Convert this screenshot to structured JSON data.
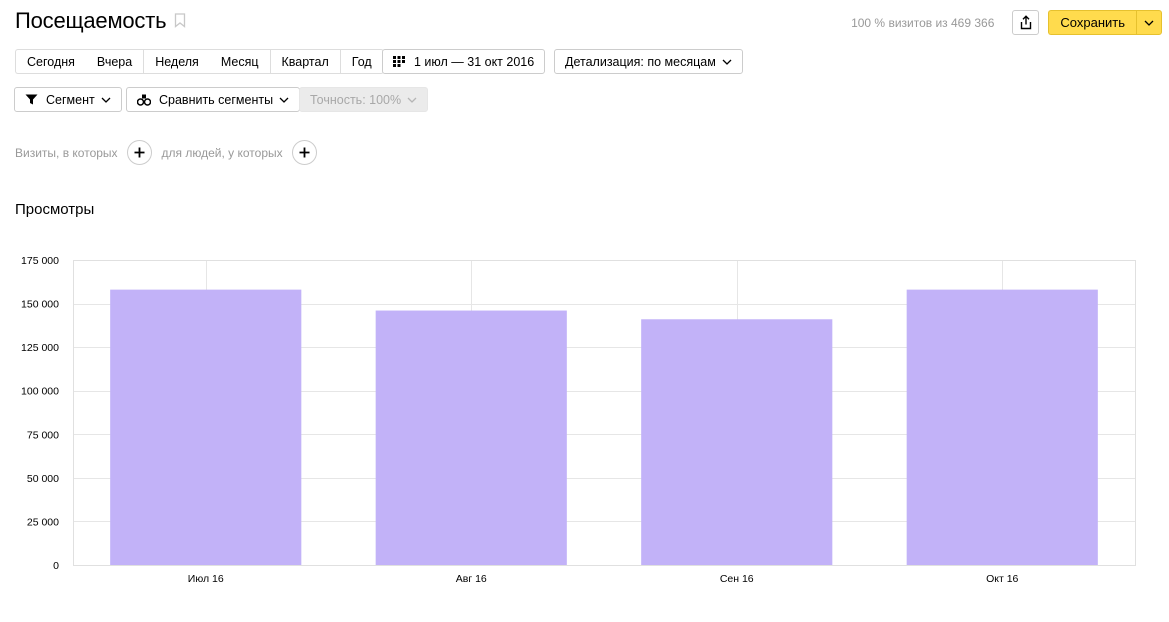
{
  "header": {
    "title": "Посещаемость",
    "visits_info": "100 % визитов из 469 366",
    "save_label": "Сохранить"
  },
  "periods": [
    "Сегодня",
    "Вчера",
    "Неделя",
    "Месяц",
    "Квартал",
    "Год"
  ],
  "date_range": "1 июл — 31 окт 2016",
  "detail_label": "Детализация: по месяцам",
  "segment_label": "Сегмент",
  "compare_label": "Сравнить сегменты",
  "accuracy_label": "Точность: 100%",
  "filters": {
    "visits_label": "Визиты, в которых",
    "people_label": "для людей, у которых"
  },
  "metric_title": "Просмотры",
  "colors": {
    "bar": "#c2b2f8",
    "save": "#ffdb4d"
  },
  "icons": [
    "bookmark-icon",
    "share-icon",
    "chevron-down-icon",
    "calendar-icon",
    "filter-icon",
    "compare-icon",
    "plus-icon"
  ],
  "chart_data": {
    "type": "bar",
    "categories": [
      "Июл 16",
      "Авг 16",
      "Сен 16",
      "Окт 16"
    ],
    "values": [
      158000,
      146000,
      141000,
      158000
    ],
    "ylim": [
      0,
      175000
    ],
    "yticks": [
      0,
      25000,
      50000,
      75000,
      100000,
      125000,
      150000,
      175000
    ],
    "ytick_labels": [
      "0",
      "25 000",
      "50 000",
      "75 000",
      "100 000",
      "125 000",
      "150 000",
      "175 000"
    ],
    "grid": true
  }
}
